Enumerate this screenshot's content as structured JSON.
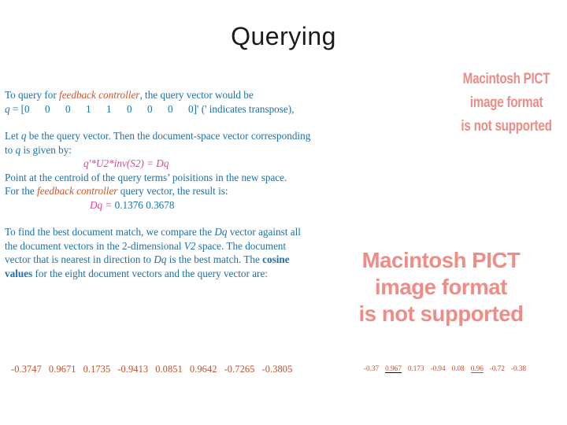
{
  "slide": {
    "title": "Querying"
  },
  "body": {
    "p1_part1": "To query for ",
    "p1_keyword": "feedback controller",
    "p1_part2": ", the query vector would be",
    "q_label": "q",
    "q_eq": " = [",
    "q_vector": [
      "0",
      "0",
      "0",
      "1",
      "1",
      "0",
      "0",
      "0",
      "0"
    ],
    "q_close": "]'",
    "q_note": "(' indicates transpose),",
    "p2_line1_a": "Let ",
    "p2_line1_q": "q",
    "p2_line1_b": " be the query vector.  Then the document-space vector corresponding to ",
    "p2_line1_q2": "q",
    "p2_line1_c": " is given by:",
    "formula1": "q'*U2*inv(S2) = Dq",
    "p3_line": "Point at the centroid of the query terms’ poisitions in the new space.",
    "p4_a": "For the ",
    "p4_keyword": "feedback controller",
    "p4_b": " query vector, the result is:",
    "formula2_label": "Dq = ",
    "formula2_values": "0.1376    0.3678",
    "p5_a": "To find the best document match, we compare the ",
    "p5_dq": "Dq",
    "p5_b": " vector against all the document vectors in the 2-dimensional ",
    "p5_v2": "V2",
    "p5_c": " space.  The document vector that is nearest in direction to ",
    "p5_dq2": "Dq",
    "p5_d": " is the best match.    The ",
    "p5_bold": "cosine values",
    "p5_e": " for the eight document vectors and the query vector are:"
  },
  "cosine_values_left": [
    "-0.3747",
    "0.9671",
    "0.1735",
    "-0.9413",
    "0.0851",
    "0.9642",
    "-0.7265",
    "-0.3805"
  ],
  "cosine_values_right": [
    {
      "value": "-0.37",
      "underline": "none"
    },
    {
      "value": "0.967",
      "underline": "black"
    },
    {
      "value": "0.173",
      "underline": "none"
    },
    {
      "value": "-0.94",
      "underline": "none"
    },
    {
      "value": "0.08",
      "underline": "none"
    },
    {
      "value": "0.96",
      "underline": "red"
    },
    {
      "value": "-0.72",
      "underline": "none"
    },
    {
      "value": "-0.38",
      "underline": "none"
    }
  ],
  "pict_small": {
    "line1": "Macintosh PICT",
    "line2": "image format",
    "line3": "is not supported"
  },
  "pict_large": {
    "line1": "Macintosh PICT",
    "line2": "image format",
    "line3": "is not supported"
  },
  "colors": {
    "body_text": "#1F6FA8",
    "keyword_red": "#D2542B",
    "formula_magenta": "#D64A95",
    "numbers_red": "#C0502A",
    "pict_placeholder": "#F08C85",
    "title": "#1a1a1a"
  }
}
